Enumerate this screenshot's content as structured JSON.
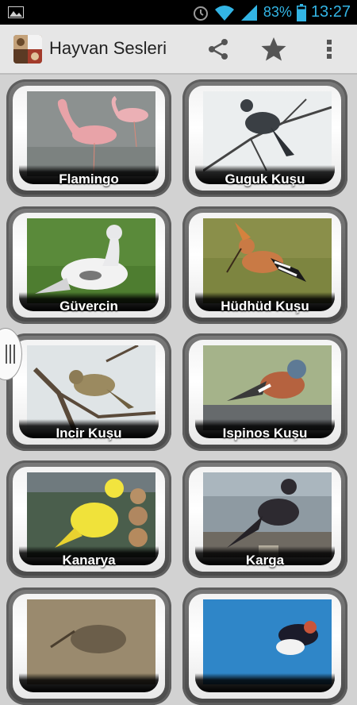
{
  "status_bar": {
    "battery_percent": "83%",
    "time": "13:27",
    "accent_color": "#33b5e5",
    "icons": [
      "picture-icon",
      "alarm-icon",
      "wifi-icon",
      "signal-icon",
      "battery-icon"
    ]
  },
  "action_bar": {
    "title": "Hayvan Sesleri",
    "icons": [
      "app-icon",
      "share-icon",
      "star-icon",
      "overflow-menu-icon"
    ]
  },
  "grid": {
    "items": [
      {
        "label": "Flamingo"
      },
      {
        "label": "Guguk Kuşu"
      },
      {
        "label": "Güvercin"
      },
      {
        "label": "Hüdhüd Kuşu"
      },
      {
        "label": "Incir Kuşu"
      },
      {
        "label": "Ispinos Kuşu"
      },
      {
        "label": "Kanarya"
      },
      {
        "label": "Karga"
      },
      {
        "label": ""
      },
      {
        "label": ""
      }
    ]
  }
}
